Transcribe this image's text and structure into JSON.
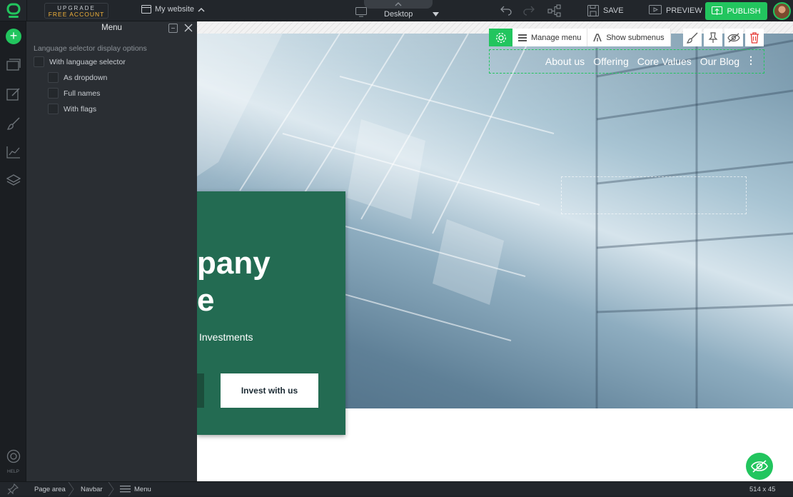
{
  "topbar": {
    "upgrade_line1": "UPGRADE",
    "upgrade_line2": "FREE ACCOUNT",
    "site_name": "My website",
    "device": "Desktop",
    "save": "SAVE",
    "preview": "PREVIEW",
    "publish": "PUBLISH"
  },
  "leftbar": {
    "help": "HELP"
  },
  "panel": {
    "title": "Menu",
    "section": "Language selector display options",
    "options": [
      {
        "label": "With language selector",
        "checked": false
      },
      {
        "label": "As dropdown",
        "checked": false
      },
      {
        "label": "Full names",
        "checked": false
      },
      {
        "label": "With flags",
        "checked": false
      }
    ]
  },
  "canvas": {
    "toolbar": {
      "manage_menu": "Manage menu",
      "show_submenus": "Show submenus"
    },
    "menu": [
      "About us",
      "Offering",
      "Core Values",
      "Our Blog"
    ],
    "hero_line1": "pany",
    "hero_line2": "e",
    "hero_sub": "Investments",
    "cta_button": "Invest with us"
  },
  "statusbar": {
    "crumbs": [
      "Page area",
      "Navbar",
      "Menu"
    ],
    "size": "514 x 45"
  },
  "colors": {
    "accent": "#22c55e",
    "panel_bg": "#2a2e33",
    "hero_green": "#236b52",
    "upgrade_text": "#f5b53c"
  }
}
